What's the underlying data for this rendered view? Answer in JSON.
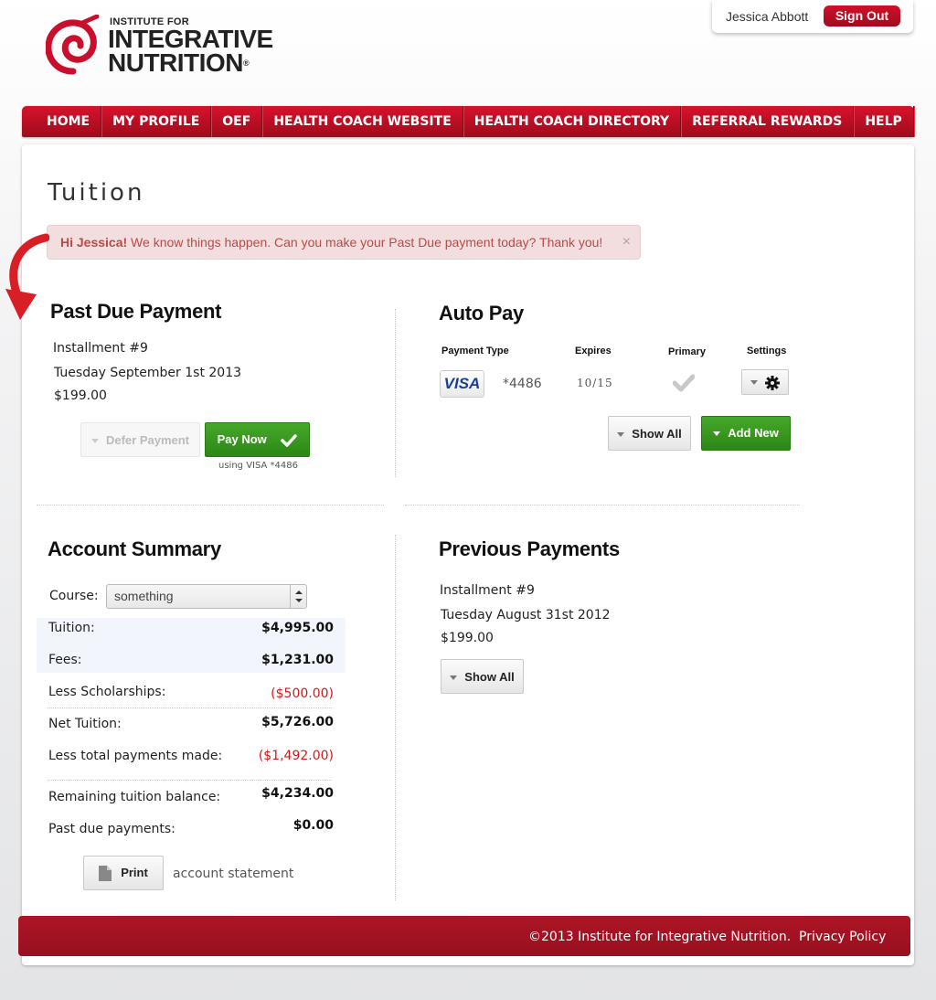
{
  "logo": {
    "line1": "INSTITUTE FOR",
    "line2": "INTEGRATIVE",
    "line3": "NUTRITION",
    "reg": "®"
  },
  "user": {
    "name": "Jessica Abbott",
    "sign_out": "Sign Out"
  },
  "nav": [
    "HOME",
    "MY PROFILE",
    "OEF",
    "HEALTH COACH WEBSITE",
    "HEALTH COACH DIRECTORY",
    "REFERRAL REWARDS",
    "HELP"
  ],
  "page_title": "Tuition",
  "alert": {
    "greeting": "Hi Jessica!",
    "message": " We know things happen. Can you make your Past Due payment today? Thank you!",
    "close": "×"
  },
  "past_due": {
    "title": "Past Due Payment",
    "installment": "Installment #9",
    "date": "Tuesday September 1st  2013",
    "amount": "$199.00",
    "defer_label": "Defer Payment",
    "pay_label": "Pay Now",
    "using": "using VISA *4486"
  },
  "auto_pay": {
    "title": "Auto Pay",
    "headers": {
      "type": "Payment Type",
      "expires": "Expires",
      "primary": "Primary",
      "settings": "Settings"
    },
    "card": {
      "brand": "VISA",
      "number": "*4486",
      "expires": "10/15"
    },
    "show_all": "Show All",
    "add_new": "Add New"
  },
  "account_summary": {
    "title": "Account Summary",
    "course_label": "Course:",
    "course_value": "something",
    "rows": [
      {
        "label": "Tuition:",
        "value": "$4,995.00"
      },
      {
        "label": "Fees:",
        "value": "$1,231.00"
      },
      {
        "label": "Less Scholarships:",
        "value": "($500.00)"
      },
      {
        "label": "Net Tuition:",
        "value": "$5,726.00"
      },
      {
        "label": "Less total payments made:",
        "value": "($1,492.00)"
      },
      {
        "label": "Remaining tuition balance:",
        "value": "$4,234.00"
      },
      {
        "label": "Past due payments:",
        "value": "$0.00"
      }
    ],
    "print_label": "Print",
    "statement_label": "account statement"
  },
  "previous_payments": {
    "title": "Previous Payments",
    "installment": "Installment #9",
    "date": "Tuesday August 31st  2012",
    "amount": "$199.00",
    "show_all": "Show All"
  },
  "footer": {
    "copyright": "©2013 Institute for Integrative Nutrition.",
    "privacy": "Privacy Policy"
  },
  "colors": {
    "brand_red": "#b80e23",
    "accent_green": "#3a9a20",
    "negative": "#d01a1a",
    "alert_bg": "#f2dede"
  }
}
